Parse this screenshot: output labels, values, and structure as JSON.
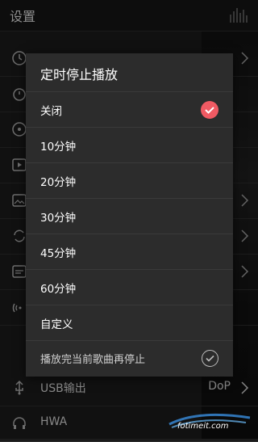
{
  "settings": {
    "title": "设置",
    "rows": [
      {
        "label": "",
        "icon": "clock-icon",
        "value": ""
      },
      {
        "label": "",
        "icon": "timer-icon",
        "value": ""
      },
      {
        "label": "",
        "icon": "disc-icon",
        "value": ""
      },
      {
        "label": "",
        "icon": "play-icon",
        "value": ""
      },
      {
        "label": "",
        "icon": "image-icon",
        "value": ""
      },
      {
        "label": "",
        "icon": "repeat-icon",
        "value": ""
      },
      {
        "label": "",
        "icon": "lyrics-icon",
        "value": ""
      },
      {
        "label": "",
        "icon": "wireless-icon",
        "value": ""
      },
      {
        "label": "USB输出",
        "icon": "usb-icon",
        "value": "DoP"
      },
      {
        "label": "HWA",
        "icon": "headphone-icon",
        "value": ""
      }
    ]
  },
  "dialog": {
    "title": "定时停止播放",
    "options": [
      {
        "label": "关闭",
        "selected": true
      },
      {
        "label": "10分钟",
        "selected": false
      },
      {
        "label": "20分钟",
        "selected": false
      },
      {
        "label": "30分钟",
        "selected": false
      },
      {
        "label": "45分钟",
        "selected": false
      },
      {
        "label": "60分钟",
        "selected": false
      },
      {
        "label": "自定义",
        "selected": false
      }
    ],
    "finish_song": {
      "label": "播放完当前歌曲再停止",
      "checked": false
    }
  },
  "watermark": {
    "text": "fotimeit.com"
  },
  "colors": {
    "accent": "#f05a63",
    "dialog_bg": "#2c2c2c",
    "page_bg": "#1b1b1b"
  }
}
